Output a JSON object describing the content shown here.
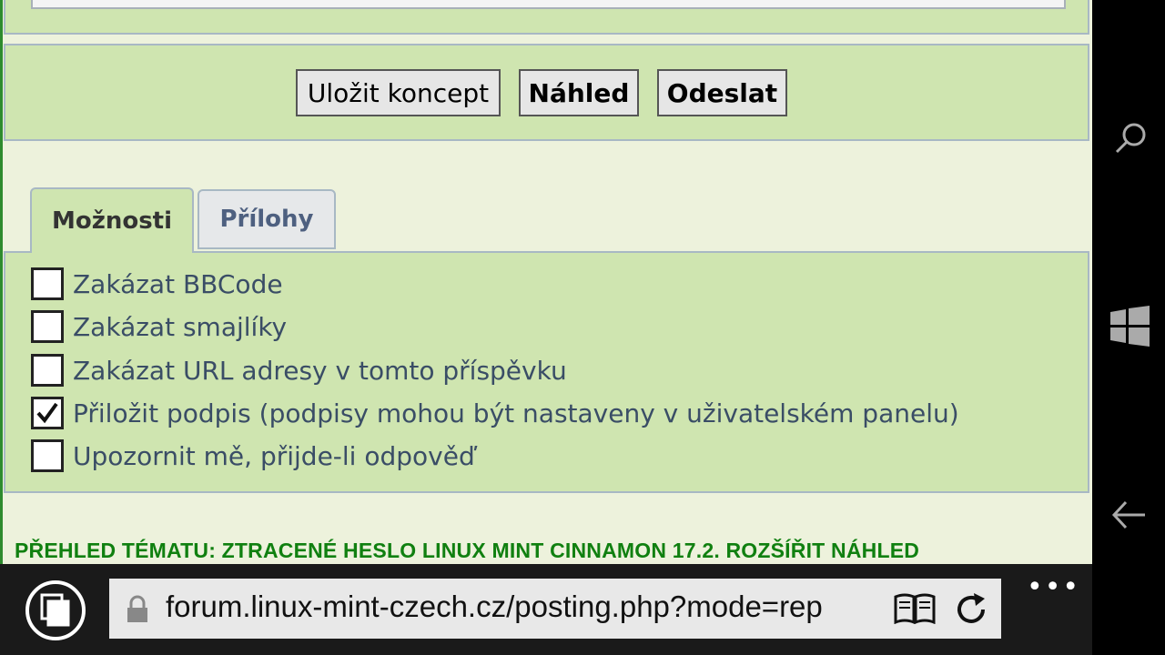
{
  "buttons": {
    "save_draft": "Uložit koncept",
    "preview": "Náhled",
    "submit": "Odeslat"
  },
  "tabs": {
    "options": "Možnosti",
    "attachments": "Přílohy"
  },
  "options": [
    {
      "label": "Zakázat BBCode",
      "checked": false
    },
    {
      "label": "Zakázat smajlíky",
      "checked": false
    },
    {
      "label": "Zakázat URL adresy v tomto příspěvku",
      "checked": false
    },
    {
      "label": "Přiložit podpis (podpisy mohou být nastaveny v uživatelském panelu)",
      "checked": true
    },
    {
      "label": "Upozornit mě, přijde-li odpověď",
      "checked": false
    }
  ],
  "topic_review": "PŘEHLED TÉMATU: ZTRACENÉ HESLO LINUX MINT CINNAMON 17.2. ROZŠÍŘIT NÁHLED",
  "browser": {
    "url": "forum.linux-mint-czech.cz/posting.php?mode=rep",
    "more": "•••"
  },
  "colors": {
    "panel_green": "#cfe5b0",
    "page_bg": "#edf2dc",
    "link_green": "#108010",
    "label_blue": "#3a4d66"
  },
  "icons": {
    "sidebar": [
      "search-icon",
      "windows-icon",
      "back-icon"
    ],
    "bottom": [
      "tabs-icon",
      "lock-icon",
      "reading-view-icon",
      "refresh-icon",
      "more-icon"
    ]
  }
}
